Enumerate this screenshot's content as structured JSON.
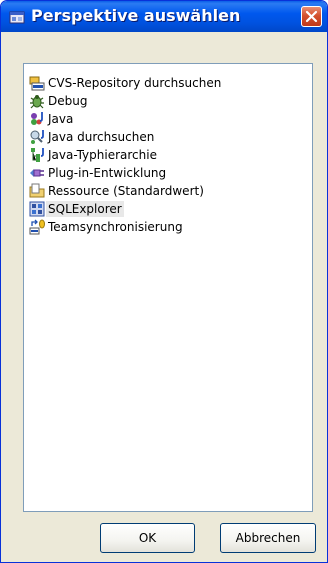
{
  "window": {
    "title": "Perspektive auswählen"
  },
  "perspectives": [
    {
      "label": "CVS-Repository durchsuchen",
      "icon": "cvs-repository-icon"
    },
    {
      "label": "Debug",
      "icon": "debug-icon"
    },
    {
      "label": "Java",
      "icon": "java-icon"
    },
    {
      "label": "Java durchsuchen",
      "icon": "java-browsing-icon"
    },
    {
      "label": "Java-Typhierarchie",
      "icon": "java-type-hierarchy-icon"
    },
    {
      "label": "Plug-in-Entwicklung",
      "icon": "plugin-development-icon"
    },
    {
      "label": "Ressource (Standardwert)",
      "icon": "resource-folder-icon"
    },
    {
      "label": "SQLExplorer",
      "icon": "sql-explorer-icon",
      "selected": true
    },
    {
      "label": "Teamsynchronisierung",
      "icon": "team-synchronize-icon"
    }
  ],
  "buttons": {
    "ok": "OK",
    "cancel": "Abbrechen"
  },
  "colors": {
    "titlebar": "#0054e3",
    "dialog_background": "#ece9d8",
    "selection": "#e8e8e8",
    "close_button": "#c0391b"
  }
}
